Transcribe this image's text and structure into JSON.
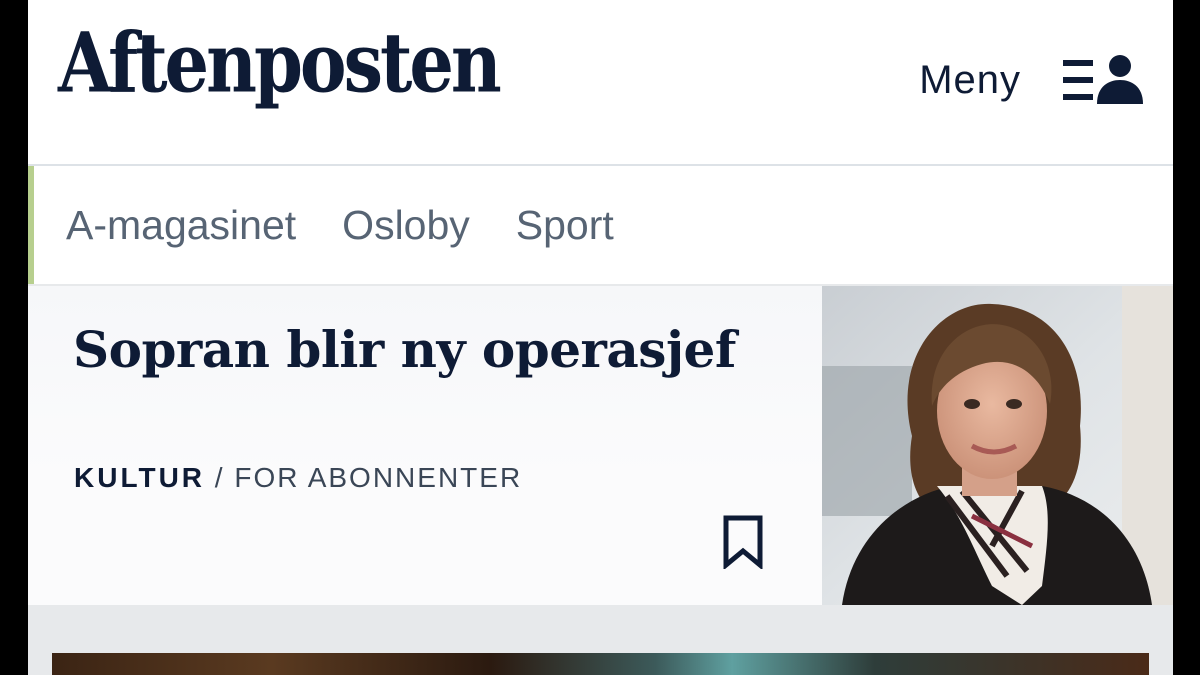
{
  "header": {
    "logo_text": "Aftenposten",
    "menu_label": "Meny",
    "menu_icon": "menu-profile-icon"
  },
  "subnav": {
    "items": [
      {
        "label": "A-magasinet"
      },
      {
        "label": "Osloby"
      },
      {
        "label": "Sport"
      }
    ],
    "accent_color": "#b7cf8e"
  },
  "article": {
    "headline": "Sopran blir ny operasjef",
    "section": "KULTUR",
    "separator": " / ",
    "access": "FOR ABONNENTER",
    "bookmark_icon": "bookmark-icon"
  },
  "colors": {
    "brand_navy": "#0e1b35",
    "nav_text": "#576474"
  }
}
